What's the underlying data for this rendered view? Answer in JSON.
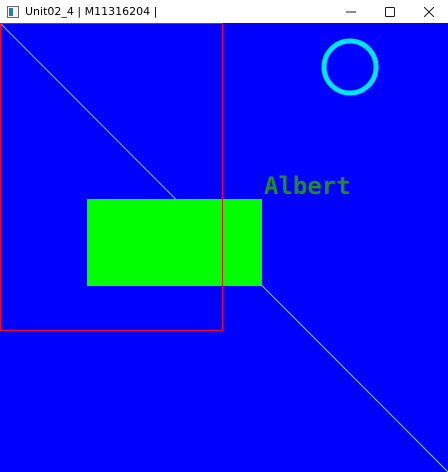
{
  "window": {
    "title": "Unit02_4 | M11316204 |"
  },
  "canvas": {
    "label_text": "Albert"
  },
  "colors": {
    "canvas_bg": "#0000ff",
    "diagonal_line": "#7fd3a8",
    "outline_rect": "#ff0033",
    "filled_rect": "#00ff00",
    "circle_stroke": "#00e5ff",
    "label_text": "#228b22"
  },
  "icons": {
    "app": "window-app-icon",
    "minimize": "minimize-icon",
    "maximize": "maximize-icon",
    "close": "close-icon"
  }
}
